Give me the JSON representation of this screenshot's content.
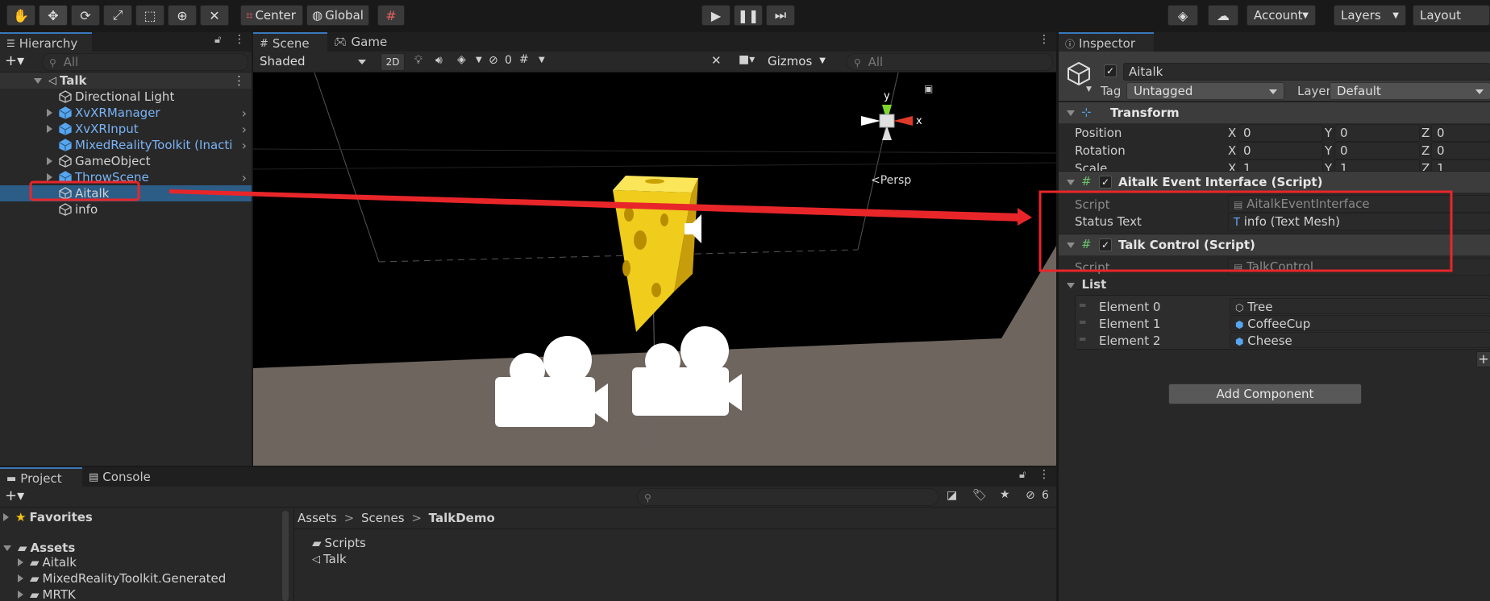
{
  "toolbar": {
    "tools": [
      "hand-tool",
      "move-tool",
      "rotate-tool",
      "scale-tool",
      "rect-tool",
      "transform-tool",
      "custom-tool"
    ],
    "pivot": "Center",
    "space": "Global",
    "account": "Account",
    "layers": "Layers",
    "layout": "Layout"
  },
  "hierarchy": {
    "tab": "Hierarchy",
    "search_placeholder": "All",
    "scene": "Talk",
    "items": [
      {
        "name": "Directional Light",
        "prefab": false,
        "expand": false,
        "arrow": false
      },
      {
        "name": "XvXRManager",
        "prefab": true,
        "expand": true,
        "arrow": true
      },
      {
        "name": "XvXRInput",
        "prefab": true,
        "expand": true,
        "arrow": true
      },
      {
        "name": "MixedRealityToolkit (Inacti",
        "prefab": true,
        "expand": false,
        "arrow": true
      },
      {
        "name": "GameObject",
        "prefab": false,
        "expand": true,
        "arrow": false
      },
      {
        "name": "ThrowScene",
        "prefab": true,
        "expand": true,
        "arrow": true
      },
      {
        "name": "Aitalk",
        "prefab": false,
        "expand": false,
        "arrow": false,
        "selected": true
      },
      {
        "name": "info",
        "prefab": false,
        "expand": false,
        "arrow": false
      }
    ]
  },
  "scene": {
    "tabs": [
      "Scene",
      "Game"
    ],
    "shading": "Shaded",
    "mode2d": "2D",
    "hidden_count": "0",
    "gizmos": "Gizmos",
    "search_placeholder": "All",
    "persp": "Persp",
    "axis_y": "y",
    "axis_x": "x"
  },
  "inspector": {
    "tab": "Inspector",
    "object_name": "Aitalk",
    "tag_label": "Tag",
    "tag_value": "Untagged",
    "layer_label": "Layer",
    "layer_value": "Default",
    "transform": {
      "title": "Transform",
      "rows": [
        {
          "label": "Position",
          "x": "0",
          "y": "0",
          "z": "0"
        },
        {
          "label": "Rotation",
          "x": "0",
          "y": "0",
          "z": "0"
        },
        {
          "label": "Scale",
          "x": "1",
          "y": "1",
          "z": "1"
        }
      ]
    },
    "event_interface": {
      "title": "Aitalk Event Interface (Script)",
      "script_label": "Script",
      "script_value": "AitalkEventInterface",
      "status_label": "Status Text",
      "status_value": "info (Text Mesh)"
    },
    "talk_control": {
      "title": "Talk Control (Script)",
      "script_label": "Script",
      "script_value": "TalkControl",
      "list_label": "List",
      "elements": [
        {
          "label": "Element 0",
          "value": "Tree",
          "icon": "gameobject-icon"
        },
        {
          "label": "Element 1",
          "value": "CoffeeCup",
          "icon": "prefab-icon"
        },
        {
          "label": "Element 2",
          "value": "Cheese",
          "icon": "prefab-icon"
        }
      ]
    },
    "add_component": "Add Component"
  },
  "project": {
    "tabs": [
      "Project",
      "Console"
    ],
    "favorites": "Favorites",
    "assets": "Assets",
    "folders": [
      "Aitalk",
      "MixedRealityToolkit.Generated",
      "MRTK"
    ],
    "breadcrumb": [
      "Assets",
      "Scenes",
      "TalkDemo"
    ],
    "files": [
      {
        "name": "Scripts",
        "icon": "folder-icon"
      },
      {
        "name": "Talk",
        "icon": "unity-scene-icon"
      }
    ],
    "hidden_count": "6"
  },
  "annotation": {
    "color": "#e8262a"
  }
}
